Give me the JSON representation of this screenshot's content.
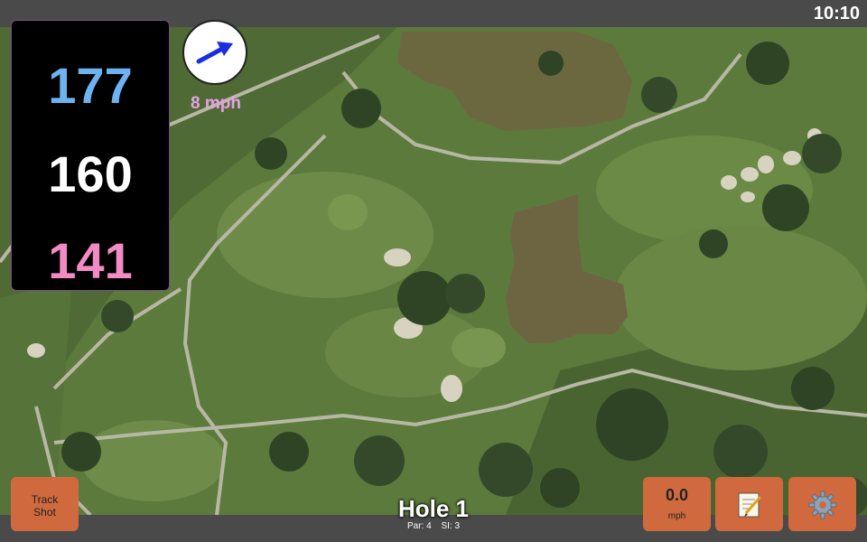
{
  "status_bar": {
    "time": "10:10"
  },
  "distances": {
    "back": "177",
    "middle": "160",
    "front": "141",
    "colors": {
      "back": "#6db3f2",
      "middle": "#ffffff",
      "front": "#f28bc4"
    }
  },
  "wind": {
    "speed_label": "8 mph",
    "icon": "wind-direction-arrow-icon",
    "arrow_color": "#1a2de0",
    "label_color": "#e8a0e8"
  },
  "buttons": {
    "track_shot": {
      "line1": "Track",
      "line2": "Shot"
    },
    "speed": {
      "value": "0.0",
      "unit": "mph"
    },
    "notes": {
      "icon": "notepad-icon"
    },
    "settings": {
      "icon": "gear-icon"
    },
    "color": "#d06a3e"
  },
  "hole": {
    "title": "Hole 1",
    "par": "Par: 4",
    "stroke_index": "SI: 3"
  },
  "map": {
    "type": "satellite-course-map"
  }
}
